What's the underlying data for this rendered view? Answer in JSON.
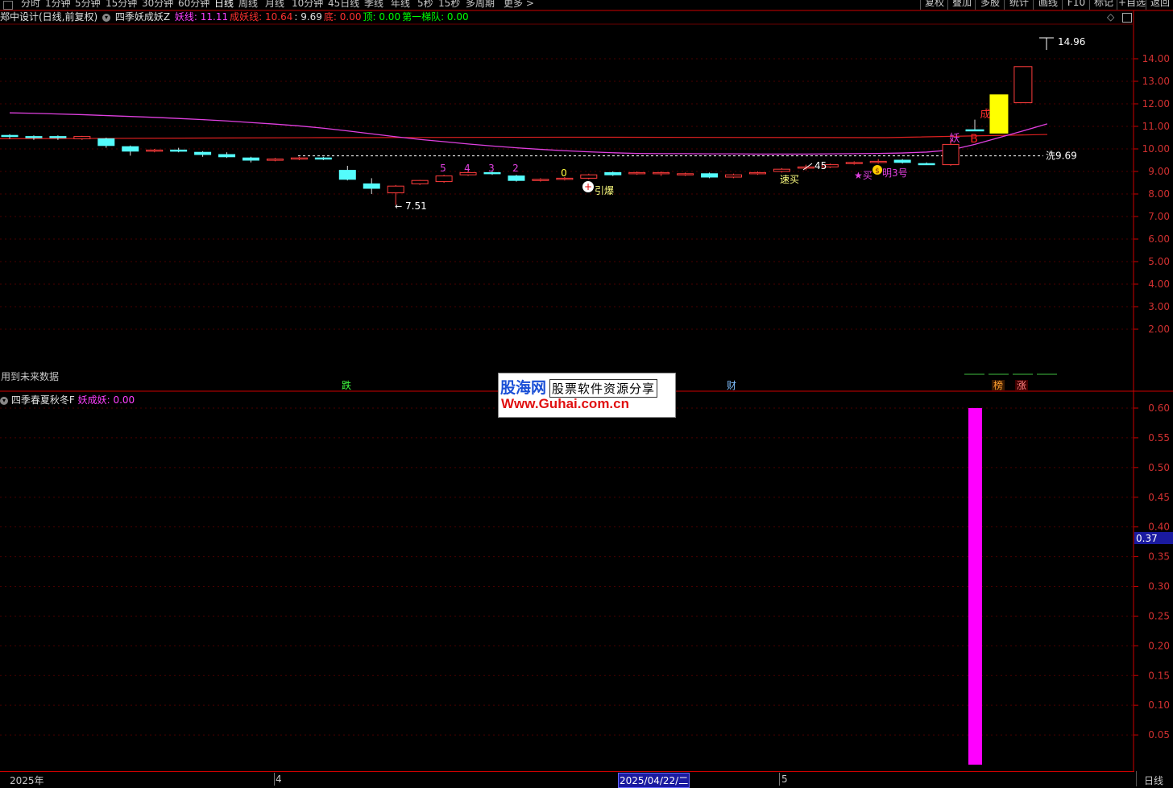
{
  "toolbar": {
    "left_items": [
      "分时",
      "1分钟",
      "5分钟",
      "15分钟",
      "30分钟",
      "60分钟",
      "日线",
      "周线",
      "月线",
      "10分钟",
      "45日线",
      "季线",
      "年线",
      "5秒",
      "15秒",
      "多周期",
      "更多 >"
    ],
    "active_item": "日线",
    "right_items": [
      "复权",
      "叠加",
      "多股",
      "统计",
      "画线",
      "F10",
      "标记",
      "+自选",
      "返回"
    ]
  },
  "main_panel": {
    "stock_title": "郑中设计(日线,前复权)",
    "indicator_name": "四季妖成妖Z",
    "values": [
      {
        "label": "妖线",
        "value": "11.11",
        "color": "#ff40ff"
      },
      {
        "label": "成妖线",
        "value": "10.64",
        "color": "#ff3030"
      },
      {
        "label": "",
        "value": "9.69",
        "color": "#e0e0e0"
      },
      {
        "label": "底",
        "value": "0.00",
        "color": "#ff3030"
      },
      {
        "label": "顶",
        "value": "0.00",
        "color": "#00ff00"
      },
      {
        "label": "第一梯队",
        "value": "0.00",
        "color": "#00ff00"
      }
    ],
    "y_ticks": [
      "14.00",
      "13.00",
      "12.00",
      "11.00",
      "10.00",
      "9.00",
      "8.00",
      "7.00",
      "6.00",
      "5.00",
      "4.00",
      "3.00",
      "2.00"
    ],
    "high_label": "14.96",
    "wash_label": "洗9.69",
    "low_label": "7.51",
    "future_note": "用到未来数据",
    "annotations": {
      "numbers": [
        "5",
        "4",
        "3",
        "2",
        "0"
      ],
      "yinbao": "引爆",
      "suma": "速买",
      "n45": "45",
      "buy": "★买",
      "ming3": "明3号",
      "yao": "妖",
      "cheng": "成",
      "b": "B",
      "die": "跌",
      "cai": "财",
      "bang": "榜",
      "zhang": "涨"
    }
  },
  "sub_panel": {
    "indicator_name": "四季春夏秋冬F",
    "value_label": "妖成妖",
    "value": "0.00",
    "y_ticks": [
      "0.60",
      "0.55",
      "0.50",
      "0.45",
      "0.40",
      "0.35",
      "0.30",
      "0.25",
      "0.20",
      "0.15",
      "0.10",
      "0.05"
    ],
    "cursor_value": "0.37",
    "bar_value": 0.6
  },
  "bottom_bar": {
    "year_label": "2025年",
    "month4": "4",
    "cursor_date": "2025/04/22/二",
    "month5": "5",
    "period": "日线"
  },
  "watermark": {
    "logo": "股海网",
    "slogan": "股票软件资源分享",
    "url": "Www.Guhai.com.cn"
  },
  "chart_data": {
    "type": "candlestick",
    "series": [
      {
        "name": "K线",
        "candles": [
          {
            "o": 10.6,
            "c": 10.55,
            "h": 10.65,
            "l": 10.45
          },
          {
            "o": 10.55,
            "c": 10.55,
            "h": 10.6,
            "l": 10.4
          },
          {
            "o": 10.55,
            "c": 10.5,
            "h": 10.6,
            "l": 10.4
          },
          {
            "o": 10.45,
            "c": 10.55,
            "h": 10.58,
            "l": 10.4
          },
          {
            "o": 10.45,
            "c": 10.15,
            "h": 10.5,
            "l": 10.05
          },
          {
            "o": 10.1,
            "c": 9.9,
            "h": 10.15,
            "l": 9.7
          },
          {
            "o": 9.9,
            "c": 9.95,
            "h": 10.0,
            "l": 9.85
          },
          {
            "o": 9.95,
            "c": 9.9,
            "h": 10.05,
            "l": 9.85
          },
          {
            "o": 9.85,
            "c": 9.75,
            "h": 9.9,
            "l": 9.65
          },
          {
            "o": 9.75,
            "c": 9.65,
            "h": 9.85,
            "l": 9.6
          },
          {
            "o": 9.6,
            "c": 9.5,
            "h": 9.65,
            "l": 9.4
          },
          {
            "o": 9.5,
            "c": 9.55,
            "h": 9.6,
            "l": 9.45
          },
          {
            "o": 9.55,
            "c": 9.6,
            "h": 9.65,
            "l": 9.5
          },
          {
            "o": 9.6,
            "c": 9.55,
            "h": 9.65,
            "l": 9.5
          },
          {
            "o": 9.05,
            "c": 8.65,
            "h": 9.25,
            "l": 8.6
          },
          {
            "o": 8.45,
            "c": 8.25,
            "h": 8.7,
            "l": 8.0
          },
          {
            "o": 8.05,
            "c": 8.35,
            "h": 8.4,
            "l": 7.51
          },
          {
            "o": 8.45,
            "c": 8.6,
            "h": 8.62,
            "l": 8.4
          },
          {
            "o": 8.55,
            "c": 8.8,
            "h": 8.85,
            "l": 8.5
          },
          {
            "o": 8.85,
            "c": 8.95,
            "h": 9.0,
            "l": 8.8
          },
          {
            "o": 8.95,
            "c": 8.9,
            "h": 9.0,
            "l": 8.85
          },
          {
            "o": 8.8,
            "c": 8.6,
            "h": 8.85,
            "l": 8.55
          },
          {
            "o": 8.6,
            "c": 8.65,
            "h": 8.7,
            "l": 8.55
          },
          {
            "o": 8.65,
            "c": 8.7,
            "h": 8.75,
            "l": 8.6
          },
          {
            "o": 8.7,
            "c": 8.85,
            "h": 8.9,
            "l": 8.65
          },
          {
            "o": 8.95,
            "c": 8.85,
            "h": 9.0,
            "l": 8.8
          },
          {
            "o": 8.9,
            "c": 8.95,
            "h": 9.0,
            "l": 8.85
          },
          {
            "o": 8.9,
            "c": 8.95,
            "h": 9.0,
            "l": 8.8
          },
          {
            "o": 8.85,
            "c": 8.9,
            "h": 8.95,
            "l": 8.8
          },
          {
            "o": 8.9,
            "c": 8.75,
            "h": 8.95,
            "l": 8.7
          },
          {
            "o": 8.75,
            "c": 8.85,
            "h": 8.9,
            "l": 8.7
          },
          {
            "o": 8.9,
            "c": 8.95,
            "h": 9.0,
            "l": 8.85
          },
          {
            "o": 9.0,
            "c": 9.1,
            "h": 9.15,
            "l": 8.95
          },
          {
            "o": 9.15,
            "c": 9.2,
            "h": 9.3,
            "l": 9.05
          },
          {
            "o": 9.2,
            "c": 9.3,
            "h": 9.35,
            "l": 9.15
          },
          {
            "o": 9.35,
            "c": 9.4,
            "h": 9.45,
            "l": 9.3
          },
          {
            "o": 9.4,
            "c": 9.45,
            "h": 9.55,
            "l": 9.35
          },
          {
            "o": 9.5,
            "c": 9.4,
            "h": 9.55,
            "l": 9.35
          },
          {
            "o": 9.35,
            "c": 9.35,
            "h": 9.4,
            "l": 9.3
          },
          {
            "o": 9.3,
            "c": 10.2,
            "h": 10.4,
            "l": 9.25
          },
          {
            "o": 10.85,
            "c": 10.85,
            "h": 11.3,
            "l": 10.85
          },
          {
            "o": 10.7,
            "c": 12.4,
            "h": 12.4,
            "l": 10.7
          },
          {
            "o": 12.05,
            "c": 13.65,
            "h": 13.65,
            "l": 12.05
          }
        ]
      }
    ],
    "yao_line": [
      11.6,
      11.58,
      11.55,
      11.52,
      11.48,
      11.44,
      11.4,
      11.35,
      11.3,
      11.24,
      11.17,
      11.1,
      11.02,
      10.92,
      10.8,
      10.67,
      10.54,
      10.42,
      10.32,
      10.22,
      10.13,
      10.05,
      9.98,
      9.92,
      9.87,
      9.83,
      9.8,
      9.79,
      9.79,
      9.78,
      9.78,
      9.77,
      9.77,
      9.77,
      9.78,
      9.79,
      9.8,
      9.82,
      9.86,
      9.95,
      10.2,
      10.5,
      10.8,
      11.11
    ],
    "cheng_yao_line": 10.64,
    "wash_line": 9.69,
    "ylim": [
      1.5,
      15.3
    ],
    "sub_bars": [
      {
        "index": 40,
        "value": 0.6
      }
    ],
    "sub_ylim": [
      0,
      0.62
    ]
  }
}
